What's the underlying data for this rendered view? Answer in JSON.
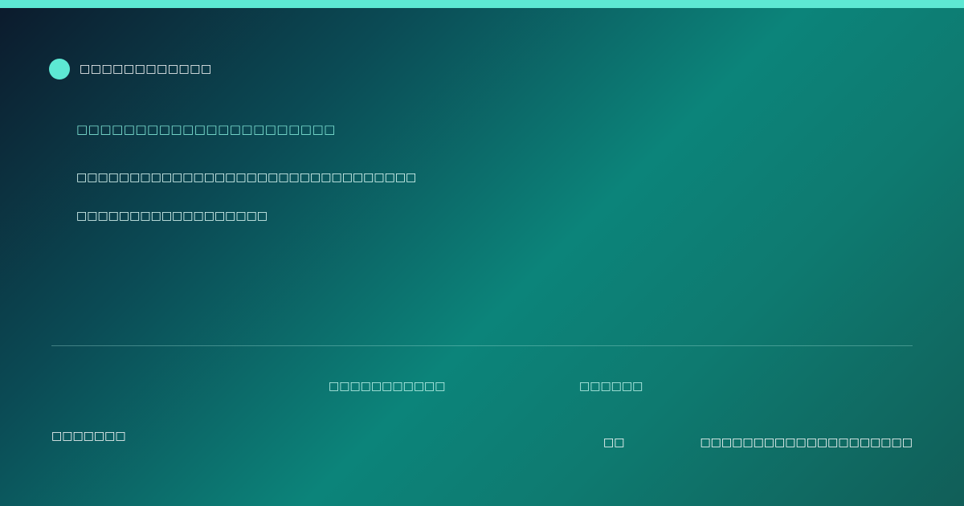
{
  "brand": {
    "name": "□□□□□□□□□□□□"
  },
  "headline": "□□□□□□□□□□□□□□□□□□□□□□",
  "body": {
    "line1": "□□□□□□□□□□□□□□□□□□□□□□□□□□□□□□□□",
    "line2": "□□□□□□□□□□□□□□□□□□"
  },
  "footer": {
    "item1": "□□□□□□□□□□□",
    "item2": "□□□□□□",
    "item3": "□□□□□□□",
    "item4": "□□",
    "item5": "□□□□□□□□□□□□□□□□□□□□"
  },
  "colors": {
    "accent": "#5de8d3",
    "headline": "#7ee3d4"
  }
}
